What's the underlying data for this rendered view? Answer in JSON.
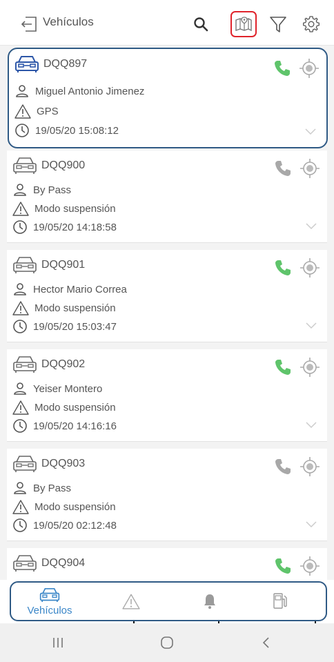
{
  "header": {
    "title": "Vehículos",
    "icons": [
      "back-arrow-icon",
      "search-icon",
      "map-pin-icon",
      "filter-icon",
      "gear-icon"
    ]
  },
  "vehicles": [
    {
      "plate": "DQQ897",
      "driver": "Miguel Antonio Jimenez",
      "status": "GPS",
      "time": "19/05/20 15:08:12",
      "phone_active": true,
      "selected": true
    },
    {
      "plate": "DQQ900",
      "driver": "By Pass",
      "status": "Modo suspensión",
      "time": "19/05/20 14:18:58",
      "phone_active": false,
      "selected": false
    },
    {
      "plate": "DQQ901",
      "driver": "Hector Mario Correa",
      "status": "Modo suspensión",
      "time": "19/05/20 15:03:47",
      "phone_active": true,
      "selected": false
    },
    {
      "plate": "DQQ902",
      "driver": "Yeiser Montero",
      "status": "Modo suspensión",
      "time": "19/05/20 14:16:16",
      "phone_active": true,
      "selected": false
    },
    {
      "plate": "DQQ903",
      "driver": "By Pass",
      "status": "Modo suspensión",
      "time": "19/05/20 02:12:48",
      "phone_active": false,
      "selected": false
    },
    {
      "plate": "DQQ904",
      "driver": "",
      "status": "",
      "time": "",
      "phone_active": true,
      "selected": false
    }
  ],
  "tabbar": {
    "vehicles_label": "Vehículos",
    "icons": [
      "car-icon",
      "warning-icon",
      "bell-icon",
      "fuel-icon"
    ]
  },
  "colors": {
    "accent": "#3a86c8",
    "selected_border": "#2f5a85",
    "map_highlight": "#e0232b",
    "phone_active": "#5fc46b",
    "phone_inactive": "#a8a8a8"
  }
}
